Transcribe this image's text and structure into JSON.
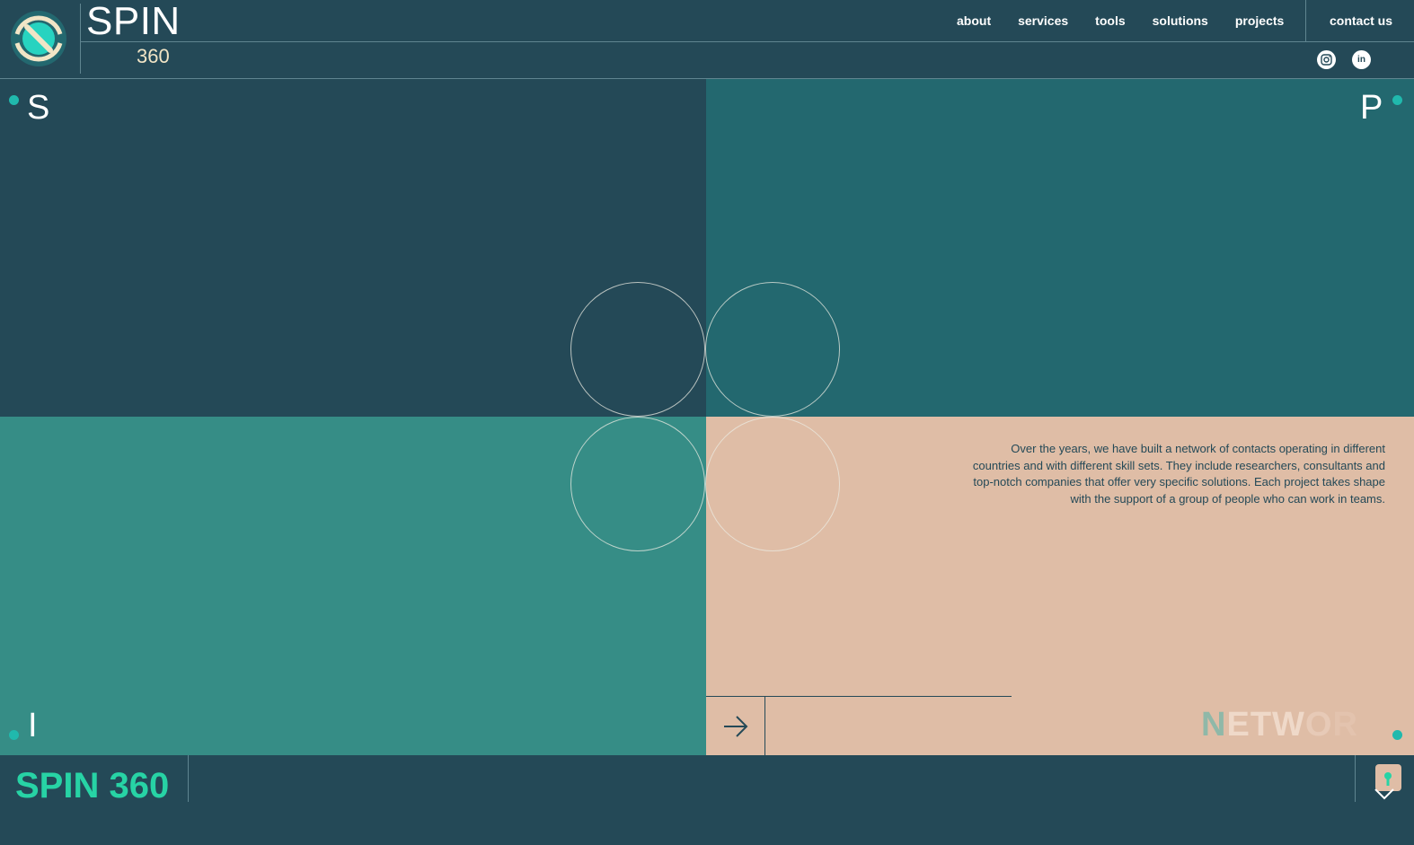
{
  "brand": {
    "name": "SPIN",
    "number": "360",
    "footer_title": "SPIN 360"
  },
  "nav": {
    "items": [
      "about",
      "services",
      "tools",
      "solutions",
      "projects"
    ],
    "contact": "contact us"
  },
  "social": [
    {
      "icon": "instagram-icon",
      "glyph": "◎"
    },
    {
      "icon": "linkedin-icon",
      "glyph": "in"
    }
  ],
  "quadrants": {
    "s": "S",
    "p": "P",
    "i": "I"
  },
  "network": {
    "text": "Over the years, we have built a network of contacts operating in different countries and with different skill sets. They include researchers, consultants and top-notch companies that offer very specific solutions. Each project takes shape with the support of a group of people who can work in teams.",
    "word_letters": [
      {
        "ch": "N",
        "color": "#8fb8a8"
      },
      {
        "ch": "E",
        "color": "#efd9c9"
      },
      {
        "ch": "T",
        "color": "#efd9c9"
      },
      {
        "ch": "W",
        "color": "#efd9c9"
      },
      {
        "ch": "O",
        "color": "#e7cab7"
      },
      {
        "ch": "R",
        "color": "#e3c3ae"
      }
    ]
  },
  "colors": {
    "dark": "#244957",
    "teal": "#23686f",
    "green": "#368d86",
    "peach": "#dfbda6",
    "accent": "#27d3a5",
    "dot": "#20b9ad"
  }
}
